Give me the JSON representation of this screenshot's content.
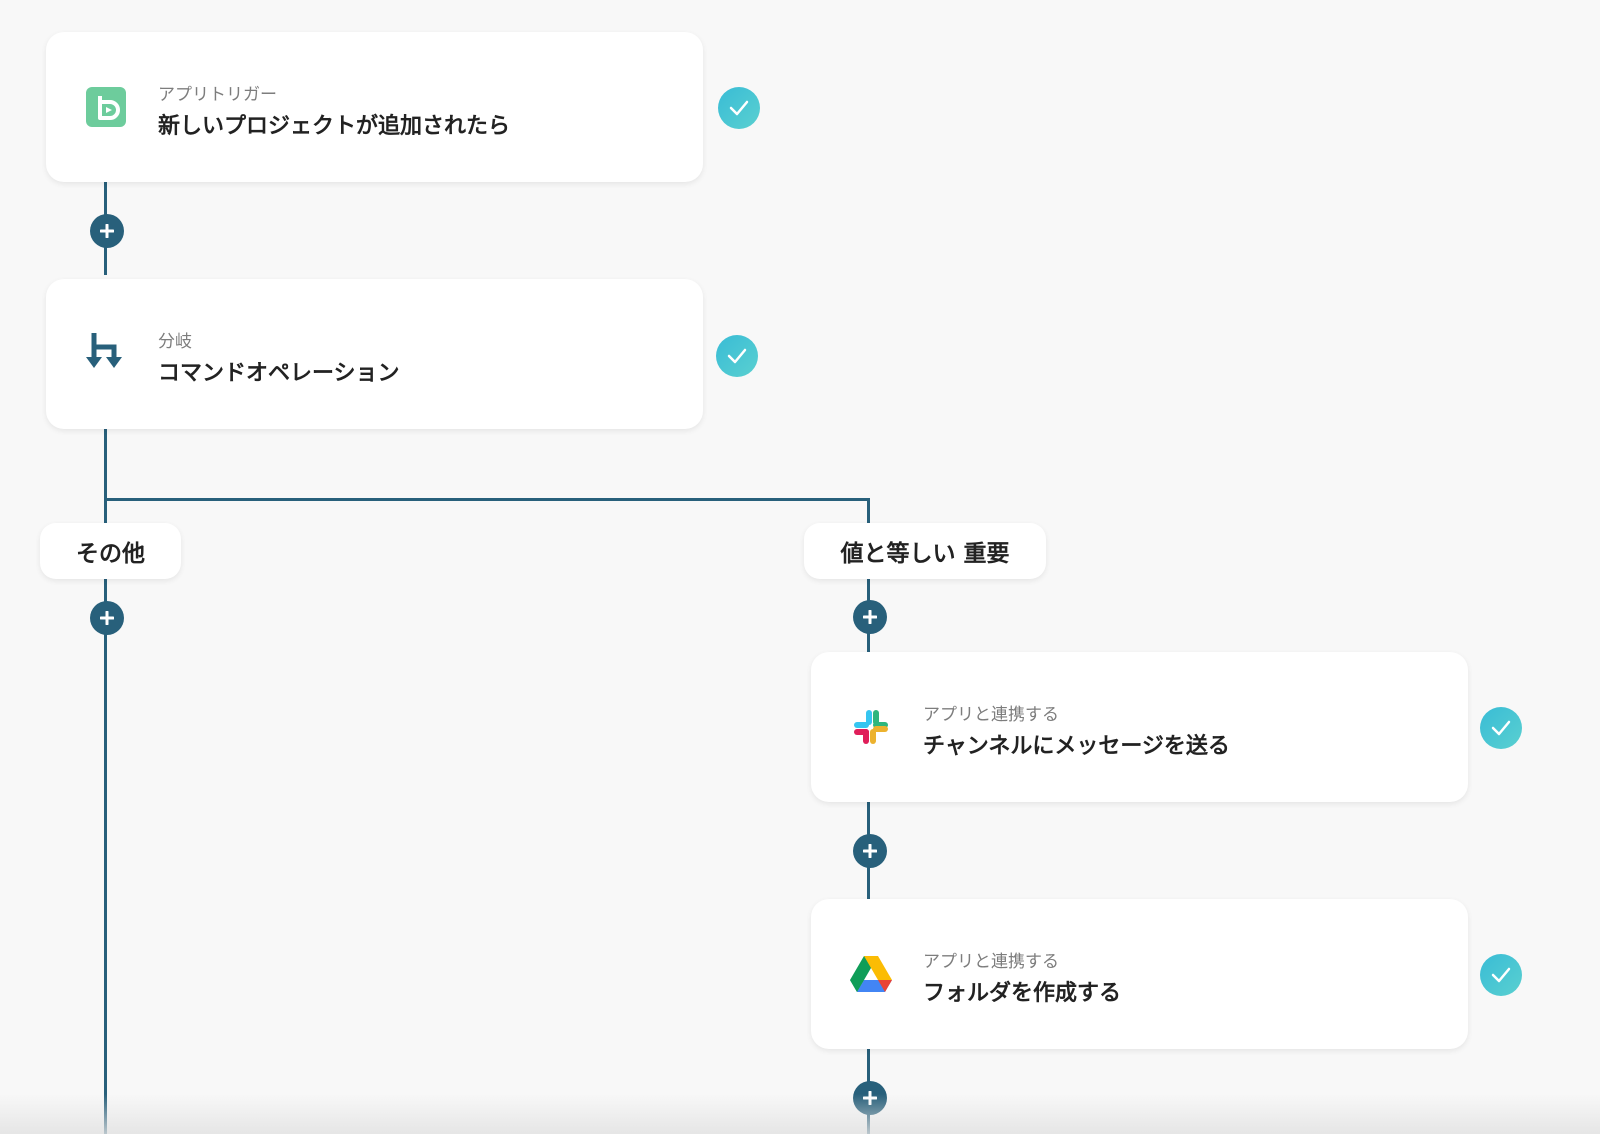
{
  "flow": {
    "trigger": {
      "sub": "アプリトリガー",
      "title": "新しいプロジェクトが追加されたら",
      "icon": "backlog-icon",
      "icon_color": "#6dcc9c"
    },
    "branch": {
      "sub": "分岐",
      "title": "コマンドオペレーション",
      "icon": "branch-icon",
      "icon_color": "#28607b"
    },
    "branches": {
      "other": {
        "label": "その他"
      },
      "match": {
        "label": "値と等しい 重要"
      }
    },
    "slack_step": {
      "sub": "アプリと連携する",
      "title": "チャンネルにメッセージを送る",
      "icon": "slack-icon"
    },
    "drive_step": {
      "sub": "アプリと連携する",
      "title": "フォルダを作成する",
      "icon": "google-drive-icon"
    }
  },
  "colors": {
    "connector": "#28607b",
    "check": "#39bcd6",
    "background": "#f8f8f8"
  }
}
